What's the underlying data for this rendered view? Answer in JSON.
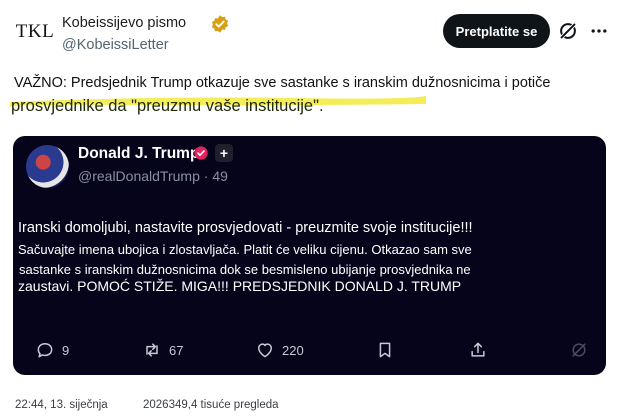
{
  "header": {
    "avatar_text": "TKL",
    "display_name": "Kobeissijevo pismo",
    "handle": "@KobeissiLetter",
    "subscribe_label": "Pretplatite se"
  },
  "tweet": {
    "line1": "VAŽNO: Predsjednik Trump otkazuje sve sastanke s iranskim dužnosnicima i potiče",
    "line2": "prosvjednike da \"preuzmu vaše institucije\"."
  },
  "quote": {
    "name": "Donald J. Trump",
    "handle": "@realDonaldTrump",
    "time": "49",
    "lines": [
      "Iranski domoljubi, nastavite prosvjedovati - preuzmite svoje institucije!!!",
      "Sačuvajte imena ubojica i zlostavljača. Platit će veliku cijenu. Otkazao sam sve",
      "sastanke s iranskim dužnosnicima dok se besmisleno ubijanje prosvjednika ne",
      "zaustavi. POMOĆ STIŽE. MIGA!!! PREDSJEDNIK DONALD J. TRUMP"
    ],
    "actions": {
      "replies": "9",
      "reposts": "67",
      "likes": "220"
    }
  },
  "footer": {
    "timestamp": "22:44, 13. siječnja",
    "views": "2026349,4 tisuće pregleda"
  },
  "colors": {
    "highlight": "#f2ea3a",
    "card_bg": "#05041a",
    "badge": "#d4a017"
  }
}
